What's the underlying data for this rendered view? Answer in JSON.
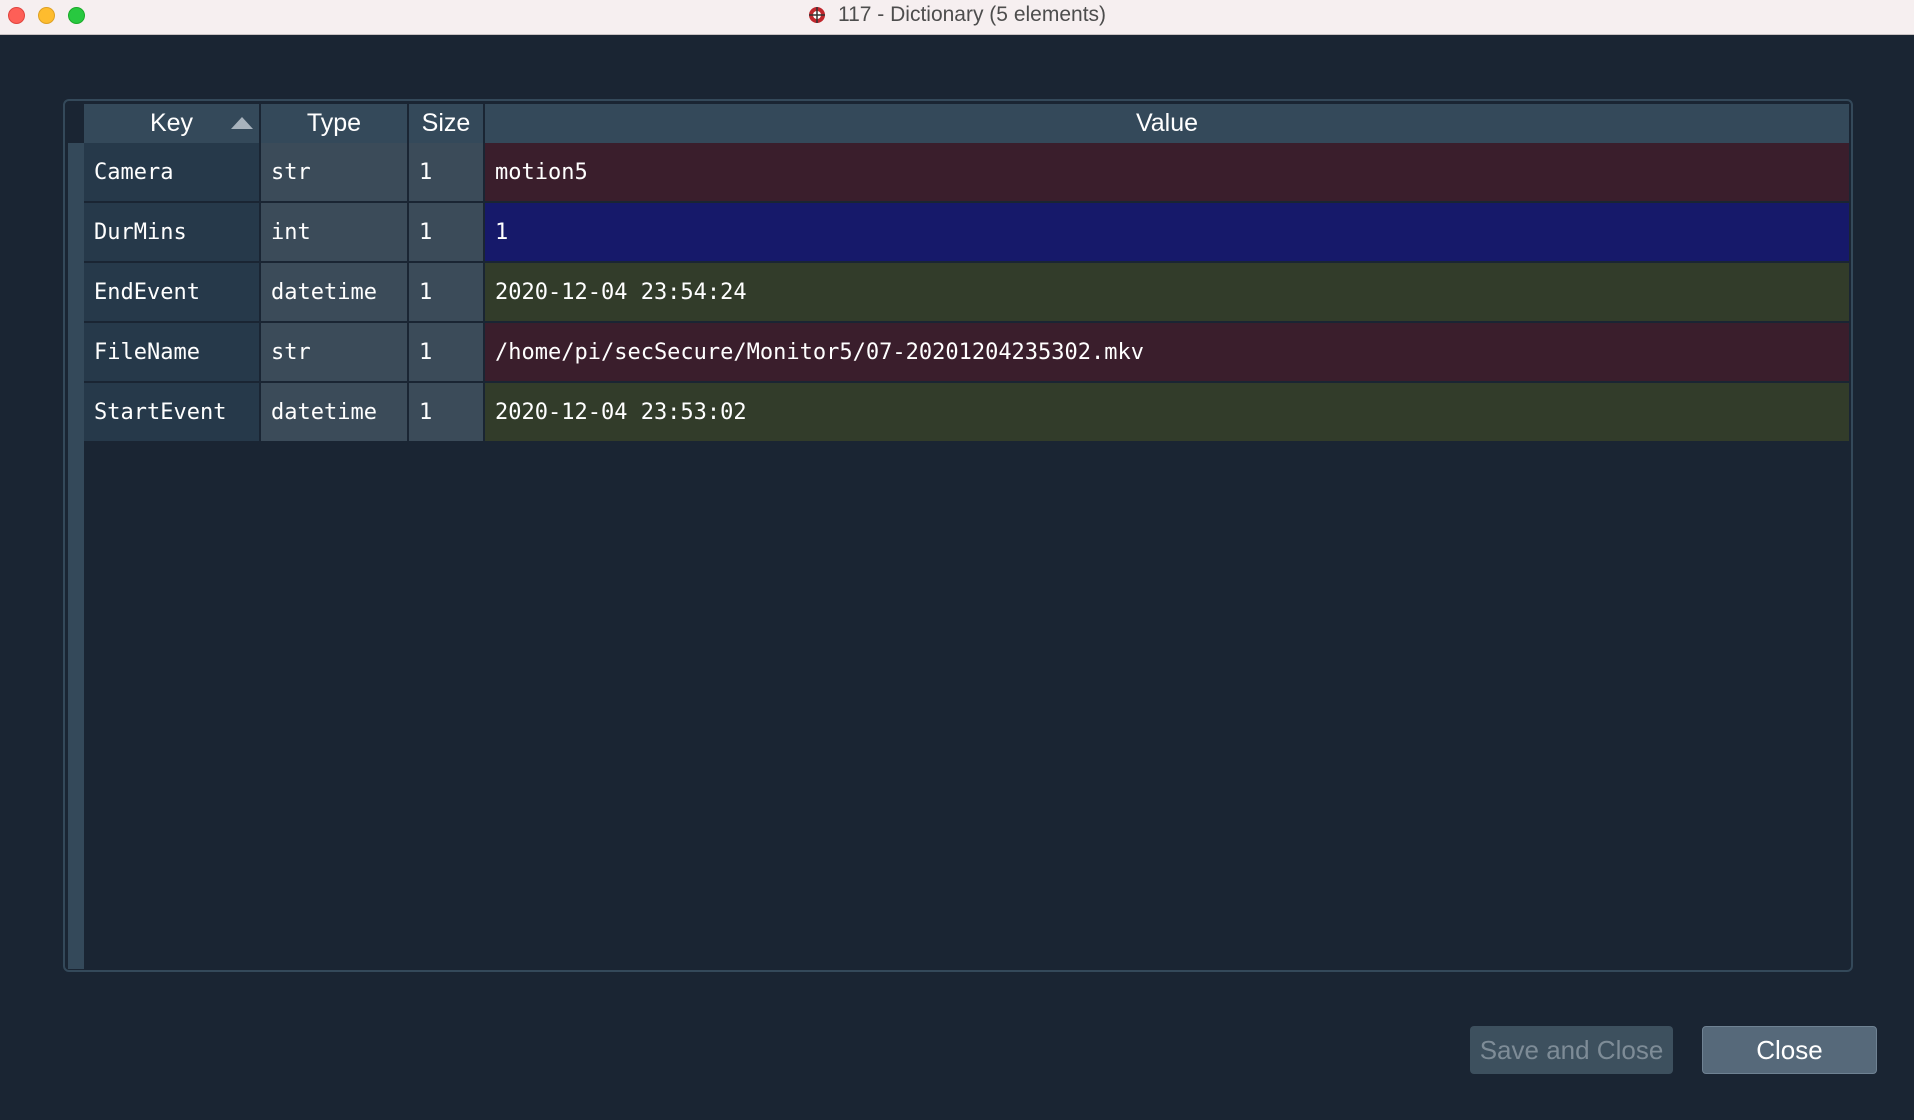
{
  "window": {
    "title": "117 - Dictionary (5 elements)"
  },
  "table": {
    "headers": {
      "key": "Key",
      "type": "Type",
      "size": "Size",
      "value": "Value"
    },
    "sort": {
      "column": "Key",
      "direction": "ascending"
    },
    "rows": [
      {
        "key": "Camera",
        "type": "str",
        "size": "1",
        "value": "motion5",
        "color": "#3a1e2c"
      },
      {
        "key": "DurMins",
        "type": "int",
        "size": "1",
        "value": "1",
        "color": "#16196a"
      },
      {
        "key": "EndEvent",
        "type": "datetime",
        "size": "1",
        "value": "2020-12-04 23:54:24",
        "color": "#323c2a"
      },
      {
        "key": "FileName",
        "type": "str",
        "size": "1",
        "value": "/home/pi/secSecure/Monitor5/07-20201204235302.mkv",
        "color": "#3a1e2c"
      },
      {
        "key": "StartEvent",
        "type": "datetime",
        "size": "1",
        "value": "2020-12-04 23:53:02",
        "color": "#323c2a"
      }
    ]
  },
  "buttons": {
    "save_and_close": "Save and Close",
    "close": "Close"
  },
  "colors": {
    "background": "#1a2533",
    "header": "#34495a",
    "str_value": "#3a1e2c",
    "int_value": "#16196a",
    "datetime_value": "#323c2a"
  },
  "icons": {
    "app": "spyder-icon",
    "sort": "sort-ascending-icon"
  }
}
